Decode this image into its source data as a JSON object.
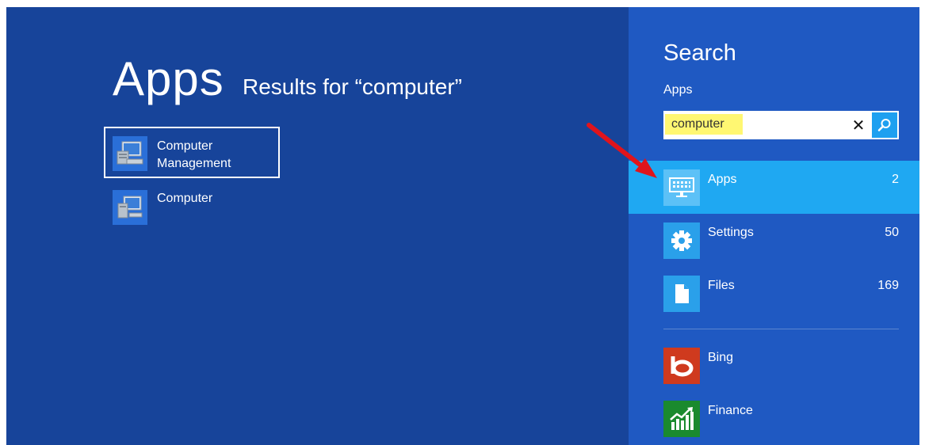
{
  "main": {
    "heading": "Apps",
    "results_label": "Results for “computer”",
    "results": [
      {
        "label": "Computer Management",
        "icon": "computer-management-icon"
      },
      {
        "label": "Computer",
        "icon": "computer-icon"
      }
    ]
  },
  "charm": {
    "title": "Search",
    "scope": "Apps",
    "search": {
      "value": "computer",
      "clear_glyph": "✕",
      "search_icon": "magnifier-icon"
    },
    "categories": [
      {
        "name": "Apps",
        "count": "2",
        "icon": "apps-keyboard-icon",
        "selected": true
      },
      {
        "name": "Settings",
        "count": "50",
        "icon": "gear-icon"
      },
      {
        "name": "Files",
        "count": "169",
        "icon": "file-icon"
      }
    ],
    "apps": [
      {
        "name": "Bing",
        "icon": "bing-icon"
      },
      {
        "name": "Finance",
        "icon": "finance-chart-icon"
      }
    ]
  },
  "colors": {
    "background": "#17449a",
    "charm_panel": "#1f59c2",
    "selected_category": "#1fa8f2",
    "search_highlight": "#fff772",
    "bing_tile": "#cf3a1e",
    "finance_tile": "#1a8a2e",
    "annotation_arrow": "#e0141c"
  }
}
